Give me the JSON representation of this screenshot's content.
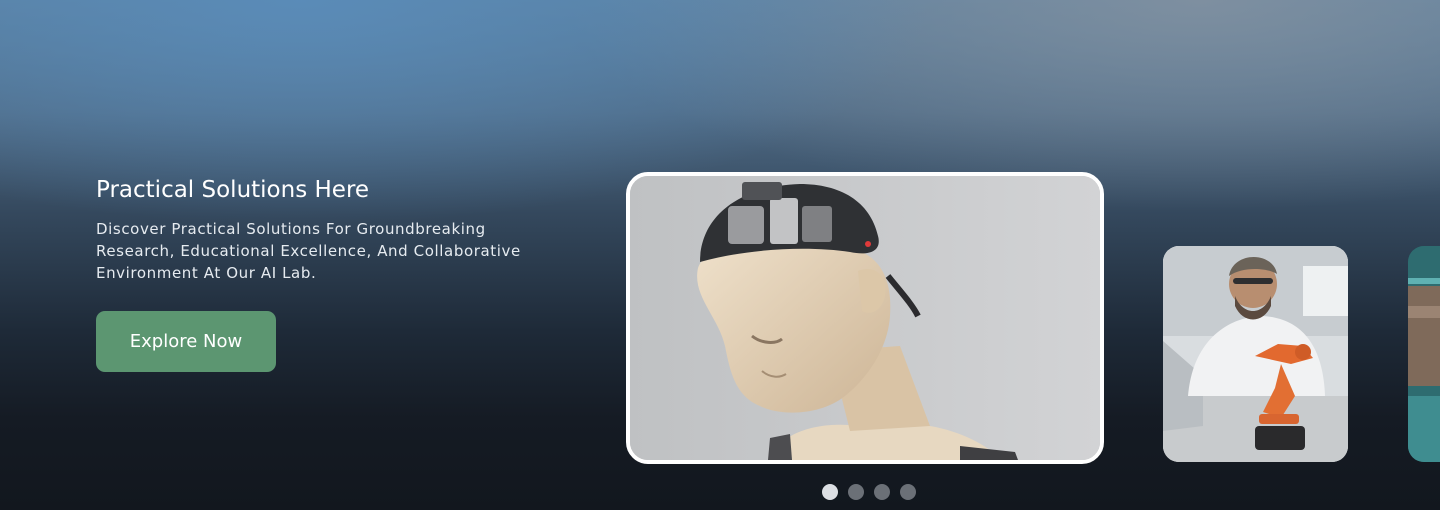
{
  "hero": {
    "title": "Practical Solutions Here",
    "description": "Discover Practical Solutions For Groundbreaking Research, Educational Excellence, And Collaborative Environment At Our AI Lab.",
    "cta_label": "Explore Now",
    "accent_color": "#5c9671"
  },
  "carousel": {
    "slides": [
      {
        "image": "humanoid-robot-head-photo"
      },
      {
        "image": "scientist-with-robotic-arm-photo"
      },
      {
        "image": "teal-machine-partial-photo"
      }
    ],
    "dots": 4,
    "active_index": 0
  }
}
